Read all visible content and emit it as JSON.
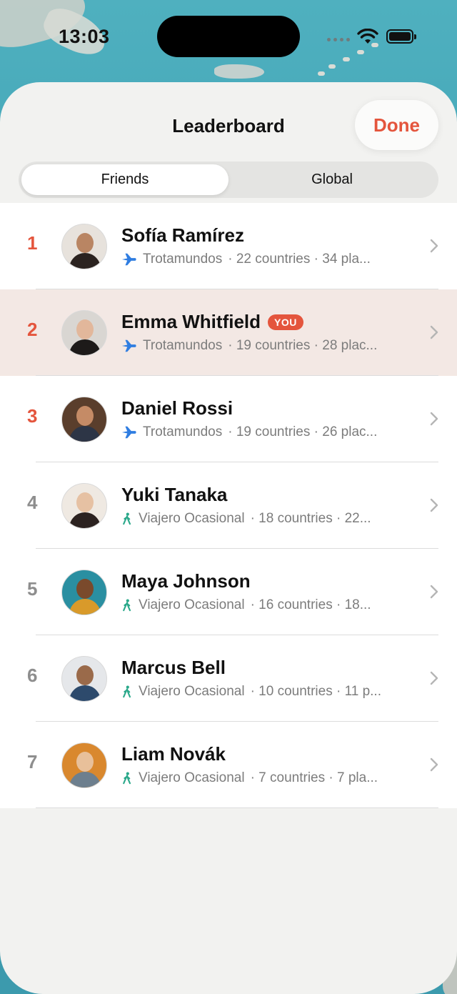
{
  "status_bar": {
    "time": "13:03"
  },
  "header": {
    "title": "Leaderboard",
    "done_label": "Done"
  },
  "tabs": [
    {
      "label": "Friends",
      "active": true
    },
    {
      "label": "Global",
      "active": false
    }
  ],
  "you_badge": "YOU",
  "colors": {
    "accent": "#e4553d",
    "plane": "#2f7de1",
    "walker": "#2aa88a",
    "you_row": "#f3e8e4"
  },
  "rows": [
    {
      "rank": "1",
      "name": "Sofía Ramírez",
      "tier_icon": "plane-icon",
      "tier": "Trotamundos",
      "stats": "· 22 countries · 34 pla...",
      "is_you": false
    },
    {
      "rank": "2",
      "name": "Emma Whitfield",
      "tier_icon": "plane-icon",
      "tier": "Trotamundos",
      "stats": "· 19 countries · 28 plac...",
      "is_you": true
    },
    {
      "rank": "3",
      "name": "Daniel Rossi",
      "tier_icon": "plane-icon",
      "tier": "Trotamundos",
      "stats": "· 19 countries · 26 plac...",
      "is_you": false
    },
    {
      "rank": "4",
      "name": "Yuki Tanaka",
      "tier_icon": "walking-person-icon",
      "tier": "Viajero Ocasional",
      "stats": "· 18 countries · 22...",
      "is_you": false
    },
    {
      "rank": "5",
      "name": "Maya Johnson",
      "tier_icon": "walking-person-icon",
      "tier": "Viajero Ocasional",
      "stats": "· 16 countries · 18...",
      "is_you": false
    },
    {
      "rank": "6",
      "name": "Marcus Bell",
      "tier_icon": "walking-person-icon",
      "tier": "Viajero Ocasional",
      "stats": "· 10 countries · 11 p...",
      "is_you": false
    },
    {
      "rank": "7",
      "name": "Liam Novák",
      "tier_icon": "walking-person-icon",
      "tier": "Viajero Ocasional",
      "stats": "· 7 countries · 7 pla...",
      "is_you": false
    }
  ]
}
